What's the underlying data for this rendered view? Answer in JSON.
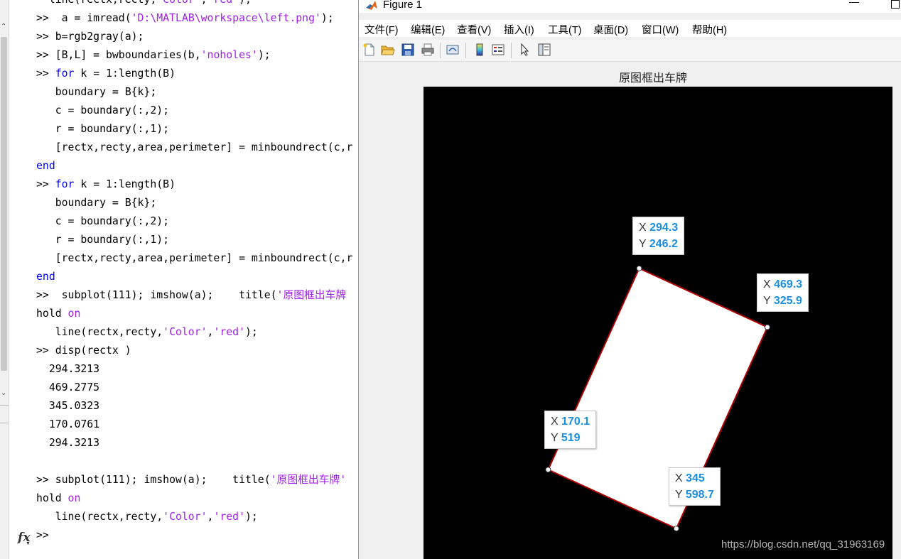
{
  "command_window": {
    "lines": [
      {
        "segs": [
          {
            "t": "  line(rectx,recty,",
            "c": "n"
          },
          {
            "t": "'Color'",
            "c": "s"
          },
          {
            "t": ",",
            "c": "n"
          },
          {
            "t": "'red'",
            "c": "s"
          },
          {
            "t": ");",
            "c": "n"
          }
        ]
      },
      {
        "segs": [
          {
            "t": ">>  a = imread(",
            "c": "n"
          },
          {
            "t": "'D:\\MATLAB\\workspace\\left.png'",
            "c": "s"
          },
          {
            "t": ");",
            "c": "n"
          }
        ]
      },
      {
        "segs": [
          {
            "t": ">> b=rgb2gray(a);",
            "c": "n"
          }
        ]
      },
      {
        "segs": [
          {
            "t": ">> [B,L] = bwboundaries(b,",
            "c": "n"
          },
          {
            "t": "'noholes'",
            "c": "s"
          },
          {
            "t": ");",
            "c": "n"
          }
        ]
      },
      {
        "segs": [
          {
            "t": ">> ",
            "c": "n"
          },
          {
            "t": "for",
            "c": "k"
          },
          {
            "t": " k = 1:length(B)",
            "c": "n"
          }
        ]
      },
      {
        "segs": [
          {
            "t": "   boundary = B{k};",
            "c": "n"
          }
        ]
      },
      {
        "segs": [
          {
            "t": "   c = boundary(:,2);",
            "c": "n"
          }
        ]
      },
      {
        "segs": [
          {
            "t": "   r = boundary(:,1);",
            "c": "n"
          }
        ]
      },
      {
        "segs": [
          {
            "t": "   [rectx,recty,area,perimeter] = minboundrect(c,r",
            "c": "n"
          }
        ]
      },
      {
        "segs": [
          {
            "t": "end",
            "c": "k"
          }
        ]
      },
      {
        "segs": [
          {
            "t": ">> ",
            "c": "n"
          },
          {
            "t": "for",
            "c": "k"
          },
          {
            "t": " k = 1:length(B)",
            "c": "n"
          }
        ]
      },
      {
        "segs": [
          {
            "t": "   boundary = B{k};",
            "c": "n"
          }
        ]
      },
      {
        "segs": [
          {
            "t": "   c = boundary(:,2);",
            "c": "n"
          }
        ]
      },
      {
        "segs": [
          {
            "t": "   r = boundary(:,1);",
            "c": "n"
          }
        ]
      },
      {
        "segs": [
          {
            "t": "   [rectx,recty,area,perimeter] = minboundrect(c,r",
            "c": "n"
          }
        ]
      },
      {
        "segs": [
          {
            "t": "end",
            "c": "k"
          }
        ]
      },
      {
        "segs": [
          {
            "t": ">>  subplot(111); imshow(a);    title(",
            "c": "n"
          },
          {
            "t": "'原图框出车牌",
            "c": "s"
          }
        ]
      },
      {
        "segs": [
          {
            "t": "hold ",
            "c": "n"
          },
          {
            "t": "on",
            "c": "s"
          }
        ]
      },
      {
        "segs": [
          {
            "t": "   line(rectx,recty,",
            "c": "n"
          },
          {
            "t": "'Color'",
            "c": "s"
          },
          {
            "t": ",",
            "c": "n"
          },
          {
            "t": "'red'",
            "c": "s"
          },
          {
            "t": ");",
            "c": "n"
          }
        ]
      },
      {
        "segs": [
          {
            "t": ">> disp(rectx )",
            "c": "n"
          }
        ]
      },
      {
        "segs": [
          {
            "t": "  294.3213",
            "c": "n"
          }
        ]
      },
      {
        "segs": [
          {
            "t": "  469.2775",
            "c": "n"
          }
        ]
      },
      {
        "segs": [
          {
            "t": "  345.0323",
            "c": "n"
          }
        ]
      },
      {
        "segs": [
          {
            "t": "  170.0761",
            "c": "n"
          }
        ]
      },
      {
        "segs": [
          {
            "t": "  294.3213",
            "c": "n"
          }
        ]
      },
      {
        "segs": [
          {
            "t": "",
            "c": "n"
          }
        ]
      },
      {
        "segs": [
          {
            "t": ">> subplot(111); imshow(a);    title(",
            "c": "n"
          },
          {
            "t": "'原图框出车牌'",
            "c": "s"
          }
        ]
      },
      {
        "segs": [
          {
            "t": "hold ",
            "c": "n"
          },
          {
            "t": "on",
            "c": "s"
          }
        ]
      },
      {
        "segs": [
          {
            "t": "   line(rectx,recty,",
            "c": "n"
          },
          {
            "t": "'Color'",
            "c": "s"
          },
          {
            "t": ",",
            "c": "n"
          },
          {
            "t": "'red'",
            "c": "s"
          },
          {
            "t": ");",
            "c": "n"
          }
        ]
      },
      {
        "segs": [
          {
            "t": ">>",
            "c": "n"
          }
        ]
      }
    ],
    "fx_label": "fx"
  },
  "figure": {
    "window_title": "Figure 1",
    "menu": [
      "文件(F)",
      "编辑(E)",
      "查看(V)",
      "插入(I)",
      "工具(T)",
      "桌面(D)",
      "窗口(W)",
      "帮助(H)"
    ],
    "toolbar_icons": [
      "new-file-icon",
      "open-folder-icon",
      "save-icon",
      "print-icon",
      "link-figure-icon",
      "colorbar-icon",
      "legend-icon",
      "pointer-arrow-icon",
      "property-inspector-icon"
    ],
    "axes_title": "原图框出车牌",
    "colors": {
      "background": "#000000",
      "polygon_fill": "#ffffff",
      "line": "#b00000",
      "value_text": "#1a8ee0"
    },
    "datatips": [
      {
        "x_label": "X",
        "x_value": "294.3",
        "y_label": "Y",
        "y_value": "246.2"
      },
      {
        "x_label": "X",
        "x_value": "469.3",
        "y_label": "Y",
        "y_value": "325.9"
      },
      {
        "x_label": "X",
        "x_value": "170.1",
        "y_label": "Y",
        "y_value": "519"
      },
      {
        "x_label": "X",
        "x_value": "345",
        "y_label": "Y",
        "y_value": "598.7"
      }
    ],
    "polygon": {
      "xlim": [
        0,
        640
      ],
      "ylim": [
        0,
        640
      ],
      "rectx": [
        294.3213,
        469.2775,
        345.0323,
        170.0761,
        294.3213
      ],
      "recty": [
        246.2,
        325.9,
        598.7,
        519,
        246.2
      ]
    },
    "watermark": "https://blog.csdn.net/qq_31963169"
  }
}
